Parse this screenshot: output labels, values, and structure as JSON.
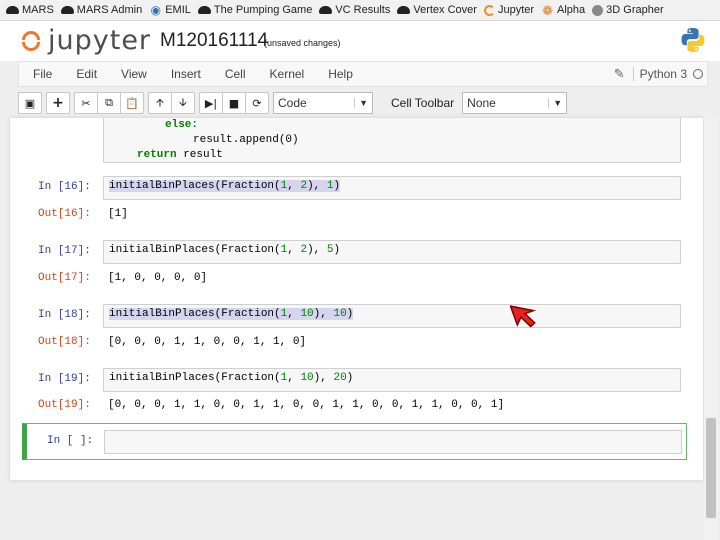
{
  "bookmarks": [
    {
      "label": "MARS",
      "icon": "hat-icon"
    },
    {
      "label": "MARS Admin",
      "icon": "hat-icon"
    },
    {
      "label": "EMIL",
      "icon": "globe-icon"
    },
    {
      "label": "The Pumping Game",
      "icon": "hat-icon"
    },
    {
      "label": "VC Results",
      "icon": "hat-icon"
    },
    {
      "label": "Vertex Cover",
      "icon": "hat-icon"
    },
    {
      "label": "Jupyter",
      "icon": "jupyter-icon"
    },
    {
      "label": "Alpha",
      "icon": "gear-icon"
    },
    {
      "label": "3D Grapher",
      "icon": "grapher-icon"
    }
  ],
  "header": {
    "logo_text": "jupyter",
    "notebook_name": "M120161114",
    "save_status": "(unsaved changes)"
  },
  "menubar": {
    "items": [
      "File",
      "Edit",
      "View",
      "Insert",
      "Cell",
      "Kernel",
      "Help"
    ],
    "kernel_name": "Python 3"
  },
  "toolbar": {
    "cell_type": "Code",
    "cell_toolbar_label": "Cell Toolbar",
    "cell_toolbar_value": "None"
  },
  "code_tail": {
    "line1": "else:",
    "line2": "result.append(0)",
    "line3_kw": "return",
    "line3_rest": " result"
  },
  "cells": [
    {
      "in_prompt": "In [16]:",
      "code_fn": "initialBinPlaces(Fraction(",
      "arg1": "1",
      "sep": ", ",
      "arg2": "2",
      "close": "), ",
      "arg3": "1",
      "end": ")",
      "out_prompt": "Out[16]:",
      "output": "[1]"
    },
    {
      "in_prompt": "In [17]:",
      "code_fn": "initialBinPlaces(Fraction(",
      "arg1": "1",
      "sep": ", ",
      "arg2": "2",
      "close": "), ",
      "arg3": "5",
      "end": ")",
      "out_prompt": "Out[17]:",
      "output": "[1, 0, 0, 0, 0]"
    },
    {
      "in_prompt": "In [18]:",
      "code_fn": "initialBinPlaces(Fraction(",
      "arg1": "1",
      "sep": ", ",
      "arg2": "10",
      "close": "), ",
      "arg3": "10",
      "end": ")",
      "out_prompt": "Out[18]:",
      "output": "[0, 0, 0, 1, 1, 0, 0, 1, 1, 0]"
    },
    {
      "in_prompt": "In [19]:",
      "code_fn": "initialBinPlaces(Fraction(",
      "arg1": "1",
      "sep": ", ",
      "arg2": "10",
      "close": "), ",
      "arg3": "20",
      "end": ")",
      "out_prompt": "Out[19]:",
      "output": "[0, 0, 0, 1, 1, 0, 0, 1, 1, 0, 0, 1, 1, 0, 0, 1, 1, 0, 0, 1]"
    }
  ],
  "empty_cell": {
    "in_prompt": "In [ ]:"
  },
  "colors": {
    "jupyter_orange": "#f37626",
    "in_prompt": "#303f9f",
    "out_prompt": "#d84315",
    "active_cell_border": "#42a545",
    "cursor_red": "#e8211d"
  }
}
